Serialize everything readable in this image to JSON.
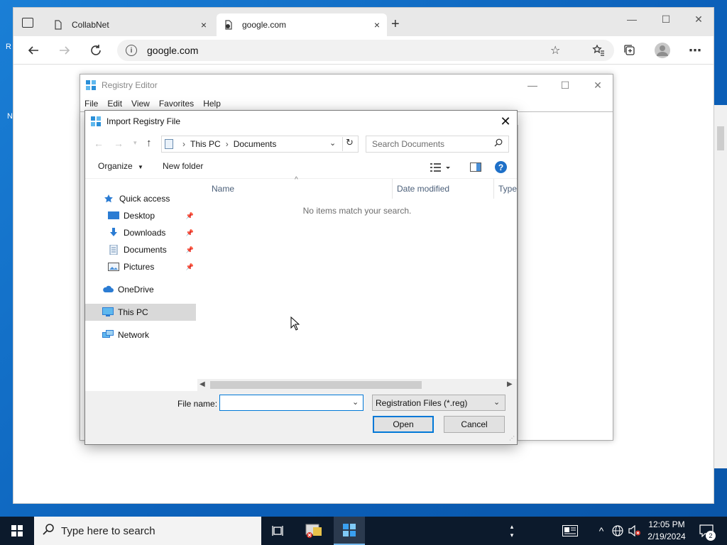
{
  "browser": {
    "tabs": [
      {
        "label": "CollabNet",
        "close": "×"
      },
      {
        "label": "google.com",
        "close": "×"
      }
    ],
    "new_tab": "+",
    "address": "google.com",
    "info_glyph": "i",
    "window_controls": {
      "minimize": "—",
      "maximize": "☐",
      "close": "✕"
    }
  },
  "regedit": {
    "title": "Registry Editor",
    "menu": [
      "File",
      "Edit",
      "View",
      "Favorites",
      "Help"
    ],
    "controls": {
      "minimize": "—",
      "maximize": "☐",
      "close": "✕"
    }
  },
  "dialog": {
    "title": "Import Registry File",
    "close": "✕",
    "breadcrumb": [
      "This PC",
      "Documents"
    ],
    "breadcrumb_sep": "›",
    "search_placeholder": "Search Documents",
    "organize": "Organize",
    "new_folder": "New folder",
    "help_glyph": "?",
    "nav": [
      {
        "label": "Quick access"
      },
      {
        "label": "Desktop",
        "pinned": true
      },
      {
        "label": "Downloads",
        "pinned": true
      },
      {
        "label": "Documents",
        "pinned": true
      },
      {
        "label": "Pictures",
        "pinned": true
      },
      {
        "label": "OneDrive"
      },
      {
        "label": "This PC",
        "selected": true
      },
      {
        "label": "Network"
      }
    ],
    "columns": [
      "Name",
      "Date modified",
      "Type"
    ],
    "empty_message": "No items match your search.",
    "file_name_label": "File name:",
    "file_name_value": "",
    "file_type": "Registration Files (*.reg)",
    "open_label": "Open",
    "cancel_label": "Cancel"
  },
  "desktop": {
    "fragments": [
      "R",
      "N"
    ]
  },
  "taskbar": {
    "search_placeholder": "Type here to search",
    "time": "12:05 PM",
    "date": "2/19/2024",
    "notification_count": "2"
  },
  "colors": {
    "accent": "#0078d7",
    "selection": "#d9d9d9",
    "taskbar": "#0c1a2c"
  }
}
